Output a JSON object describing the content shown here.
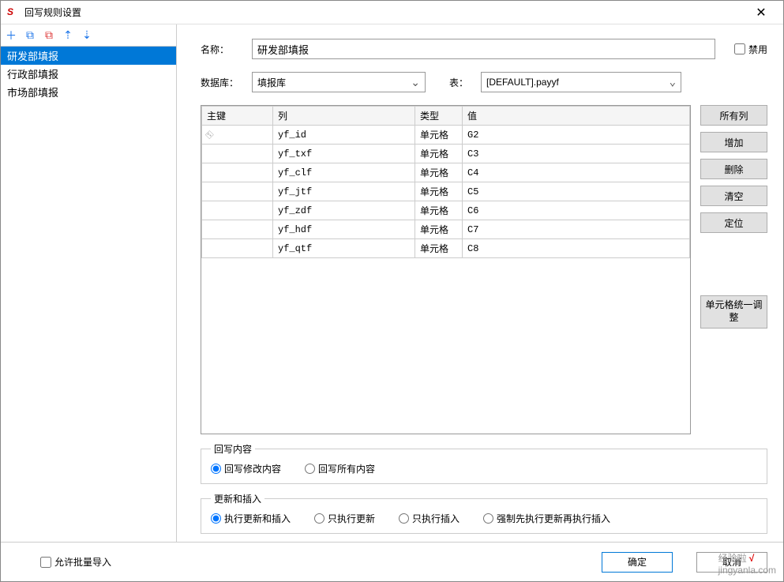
{
  "window": {
    "title": "回写规则设置"
  },
  "sidebar": {
    "items": [
      {
        "label": "研发部填报",
        "selected": true
      },
      {
        "label": "行政部填报",
        "selected": false
      },
      {
        "label": "市场部填报",
        "selected": false
      }
    ]
  },
  "form": {
    "name_label": "名称：",
    "name_value": "研发部填报",
    "disable_label": "禁用",
    "db_label": "数据库：",
    "db_value": "填报库",
    "table_label": "表：",
    "table_value": "[DEFAULT].payyf"
  },
  "table": {
    "headers": [
      "主键",
      "列",
      "类型",
      "值"
    ],
    "rows": [
      {
        "key": true,
        "col": "yf_id",
        "type": "单元格",
        "val": "G2"
      },
      {
        "key": false,
        "col": "yf_txf",
        "type": "单元格",
        "val": "C3"
      },
      {
        "key": false,
        "col": "yf_clf",
        "type": "单元格",
        "val": "C4"
      },
      {
        "key": false,
        "col": "yf_jtf",
        "type": "单元格",
        "val": "C5"
      },
      {
        "key": false,
        "col": "yf_zdf",
        "type": "单元格",
        "val": "C6"
      },
      {
        "key": false,
        "col": "yf_hdf",
        "type": "单元格",
        "val": "C7"
      },
      {
        "key": false,
        "col": "yf_qtf",
        "type": "单元格",
        "val": "C8"
      }
    ]
  },
  "buttons": {
    "all_cols": "所有列",
    "add": "增加",
    "delete": "删除",
    "clear": "清空",
    "locate": "定位",
    "cell_adjust": "单元格统一调整"
  },
  "writeback": {
    "legend": "回写内容",
    "opt1": "回写修改内容",
    "opt2": "回写所有内容"
  },
  "update_insert": {
    "legend": "更新和插入",
    "opt1": "执行更新和插入",
    "opt2": "只执行更新",
    "opt3": "只执行插入",
    "opt4": "强制先执行更新再执行插入"
  },
  "footer": {
    "batch_import": "允许批量导入",
    "ok": "确定",
    "cancel": "取消"
  },
  "watermark": {
    "text1": "经验啦",
    "text2": "jingyanla.com"
  }
}
